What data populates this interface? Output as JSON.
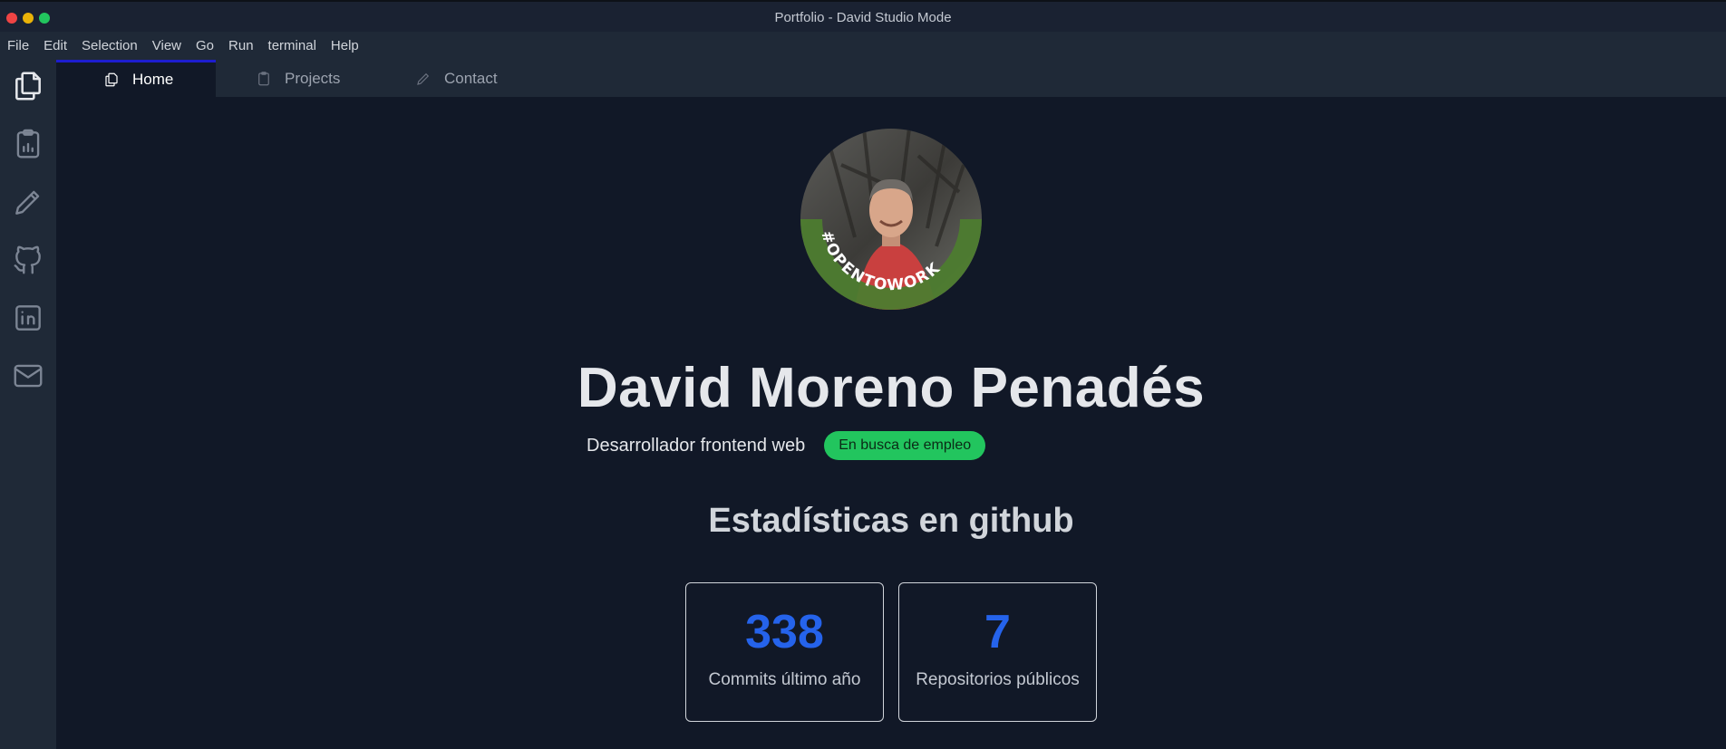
{
  "window": {
    "title": "Portfolio - David Studio Mode"
  },
  "menu": [
    "File",
    "Edit",
    "Selection",
    "View",
    "Go",
    "Run",
    "terminal",
    "Help"
  ],
  "activity_bar": {
    "icons": [
      "files-icon",
      "clipboard-icon",
      "pencil-icon",
      "github-icon",
      "linkedin-icon",
      "mail-icon"
    ]
  },
  "tabs": [
    {
      "label": "Home",
      "icon": "files-icon",
      "active": true
    },
    {
      "label": "Projects",
      "icon": "clipboard-icon",
      "active": false
    },
    {
      "label": "Contact",
      "icon": "pencil-icon",
      "active": false
    }
  ],
  "profile": {
    "name": "David Moreno Penadés",
    "role": "Desarrollador frontend web",
    "status_badge": "En busca de empleo",
    "avatar_ring_text": "#OPENTOWORK"
  },
  "stats": {
    "title": "Estadísticas en github",
    "items": [
      {
        "value": "338",
        "label": "Commits último año"
      },
      {
        "value": "7",
        "label": "Repositorios públicos"
      }
    ]
  },
  "colors": {
    "background": "#111827",
    "panel": "#1f2937",
    "accent": "#2563eb",
    "badge": "#22c55e",
    "active_tab_border": "#1d1dcf",
    "open_to_work_ring": "#4d7c2f"
  }
}
